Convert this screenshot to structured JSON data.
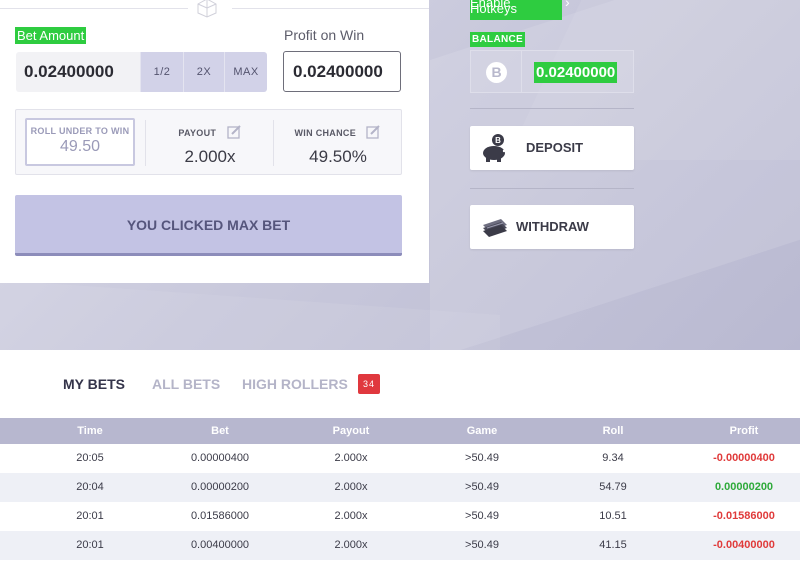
{
  "game": {
    "bet_amount_label": "Bet Amount",
    "bet_amount_value": "0.02400000",
    "bet_buttons": {
      "half": "1/2",
      "double": "2X",
      "max": "MAX"
    },
    "profit_label": "Profit on Win",
    "profit_value": "0.02400000",
    "roll_under_label": "ROLL UNDER TO WIN",
    "roll_under_value": "49.50",
    "payout_label": "PAYOUT",
    "payout_value": "2.000x",
    "win_chance_label": "WIN CHANCE",
    "win_chance_value": "49.50%",
    "action_button": "YOU CLICKED MAX BET"
  },
  "sidebar": {
    "hotkeys_label": "Enable Hotkeys",
    "balance_label": "BALANCE",
    "balance_value": "0.02400000",
    "coin_symbol": "B",
    "deposit_label": "DEPOSIT",
    "withdraw_label": "WITHDRAW"
  },
  "tabs": [
    {
      "label": "MY BETS",
      "active": true
    },
    {
      "label": "ALL BETS",
      "active": false
    },
    {
      "label": "HIGH ROLLERS",
      "active": false
    }
  ],
  "high_rollers_badge": "34",
  "table": {
    "headers": [
      "Time",
      "Bet",
      "Payout",
      "Game",
      "Roll",
      "Profit"
    ],
    "rows": [
      {
        "time": "20:05",
        "bet": "0.00000400",
        "payout": "2.000x",
        "game": ">50.49",
        "roll": "9.34",
        "profit": "-0.00000400"
      },
      {
        "time": "20:04",
        "bet": "0.00000200",
        "payout": "2.000x",
        "game": ">50.49",
        "roll": "54.79",
        "profit": "0.00000200"
      },
      {
        "time": "20:01",
        "bet": "0.01586000",
        "payout": "2.000x",
        "game": ">50.49",
        "roll": "10.51",
        "profit": "-0.01586000"
      },
      {
        "time": "20:01",
        "bet": "0.00400000",
        "payout": "2.000x",
        "game": ">50.49",
        "roll": "41.15",
        "profit": "-0.00400000"
      }
    ]
  },
  "colors": {
    "highlight_green": "#2ecc40",
    "accent_purple": "#c3c3e4",
    "negative": "#e03a3a",
    "positive": "#2eaa3a",
    "badge_red": "#e0383e"
  }
}
